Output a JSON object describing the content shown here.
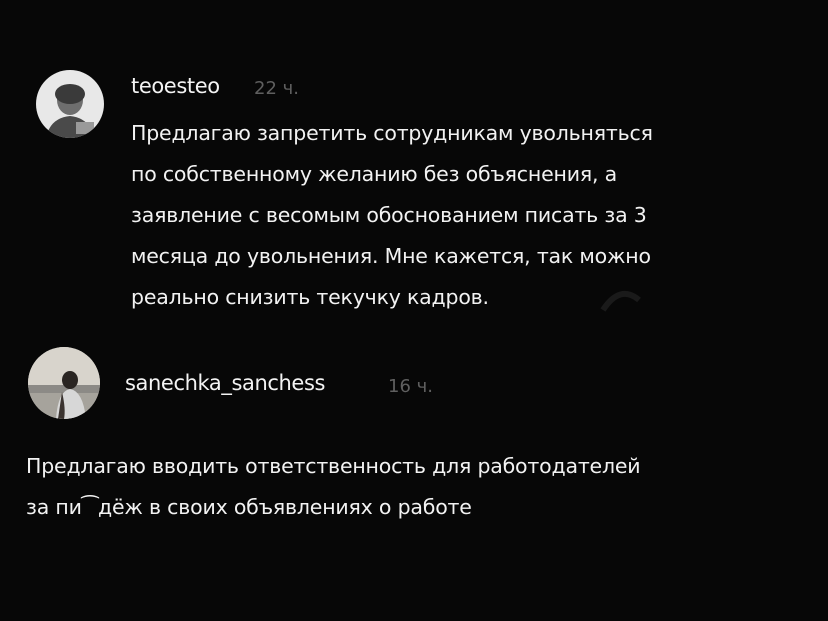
{
  "comments": [
    {
      "username": "teoesteo",
      "time": "22 ч.",
      "avatar_icon": "user-photo-icon",
      "lines": [
        "Предлагаю запретить сотрудникам увольняться",
        "по собственному желанию без объяснения, а",
        "заявление с весомым обоснованием писать за 3",
        "месяца до увольнения. Мне кажется, так можно",
        "реально снизить текучку кадров."
      ]
    },
    {
      "username": "sanechka_sanchess",
      "time": "16 ч.",
      "avatar_icon": "user-photo-icon",
      "lines": [
        "Предлагаю вводить ответственность для работодателей",
        "за пи⁀дёж в своих объявлениях о работе"
      ]
    }
  ],
  "colors": {
    "background": "#070707",
    "text": "#f2f2f2",
    "muted": "#5f5f5f"
  }
}
